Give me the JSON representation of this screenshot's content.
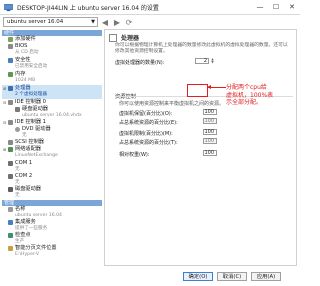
{
  "window": {
    "title": "DESKTOP-JI44LIN 上 ubuntu server 16.04 的设置",
    "controls": {
      "minimize": "—",
      "maximize": "☐",
      "close": "✕"
    }
  },
  "vm_selector": {
    "value": "ubuntu server 16.04"
  },
  "tree": {
    "hardware_header": "硬件",
    "hardware": [
      {
        "label": "添加硬件",
        "sub": ""
      },
      {
        "label": "BIOS",
        "sub": "从 CD 启动"
      },
      {
        "label": "安全性",
        "sub": "已禁用安全启动"
      },
      {
        "label": "内存",
        "sub": "1024 MB"
      },
      {
        "label": "处理器",
        "sub": "2 个虚拟处理器"
      },
      {
        "label": "IDE 控制器 0",
        "sub": ""
      },
      {
        "label": "硬盘驱动器",
        "sub": "ubuntu server 16.04.vhdx"
      },
      {
        "label": "IDE 控制器 1",
        "sub": ""
      },
      {
        "label": "DVD 驱动器",
        "sub": "无"
      },
      {
        "label": "SCSI 控制器",
        "sub": ""
      },
      {
        "label": "网络适配器",
        "sub": "LinuxNetExchange"
      },
      {
        "label": "COM 1",
        "sub": "无"
      },
      {
        "label": "COM 2",
        "sub": "无"
      },
      {
        "label": "磁盘驱动器",
        "sub": "无"
      }
    ],
    "management_header": "管理",
    "management": [
      {
        "label": "名称",
        "sub": "ubuntu server 16.04"
      },
      {
        "label": "集成服务",
        "sub": "提供了一些服务"
      },
      {
        "label": "检查点",
        "sub": "生产"
      },
      {
        "label": "智能分页文件位置",
        "sub": "E:\\Hyper-V"
      }
    ]
  },
  "processor": {
    "header": "处理器",
    "description": "你可以根据物理计算机上处理器的数量修改此虚拟机的虚拟处理器的数量。还可以修改其他资源控制设置。",
    "vcpu_label": "虚拟处理器的数量(N):",
    "vcpu_value": "2",
    "group_title": "资源控制",
    "group_desc": "你可以使用资源控制来平衡虚拟机之间的资源。",
    "reserve_label": "虚拟机保留(百分比)(O):",
    "reserve_value": "100",
    "reserve_total_label": "占总系统资源的百分比(E):",
    "reserve_total_value": "100",
    "limit_label": "虚拟机限制(百分比)(M):",
    "limit_value": "100",
    "limit_total_label": "占总系统资源的百分比(T):",
    "limit_total_value": "100",
    "weight_label": "相对权重(W):",
    "weight_value": "100"
  },
  "annotation": {
    "lines": [
      "分配两个cpu给",
      "虚拟机，100%表",
      "示全部分配。"
    ],
    "color": "#e02020"
  },
  "buttons": {
    "ok": "确定(O)",
    "cancel": "取消(C)",
    "apply": "应用(A)"
  },
  "colors": {
    "section_header": "#7aa7d8",
    "selection": "#cde4f7",
    "accent": "#3b7fd9"
  }
}
